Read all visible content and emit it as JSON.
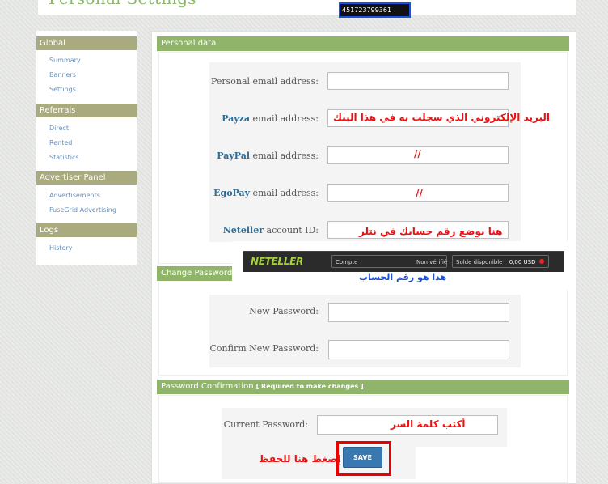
{
  "page_title": "Personal Settings",
  "sidebar": {
    "sections": [
      {
        "title": "Global",
        "items": [
          "Summary",
          "Banners",
          "Settings"
        ]
      },
      {
        "title": "Referrals",
        "items": [
          "Direct",
          "Rented",
          "Statistics"
        ]
      },
      {
        "title": "Advertiser Panel",
        "items": [
          "Advertisements",
          "FuseGrid Advertising"
        ]
      },
      {
        "title": "Logs",
        "items": [
          "History"
        ]
      }
    ]
  },
  "personal_data": {
    "header": "Personal data",
    "fields": {
      "personal_email": {
        "label": "Personal email address:",
        "value": ""
      },
      "payza": {
        "brand": "Payza",
        "label": " email address:",
        "value": ""
      },
      "paypal": {
        "brand": "PayPal",
        "label": " email address:",
        "value": ""
      },
      "egopay": {
        "brand": "EgoPay",
        "label": " email address:",
        "value": ""
      },
      "neteller": {
        "brand": "Neteller",
        "label": " account ID:",
        "value": ""
      }
    }
  },
  "annotations": {
    "payza_note": "البريد الإلكتروني الذي سجلت به في هذا البنك",
    "paypal_note": "//",
    "egopay_note": "//",
    "neteller_note": "هنا يوضع رقم حسابك في نتلر",
    "account_number_note": "هذا هو رقم الحساب",
    "password_note": "أكتب كلمة السر",
    "save_note": "إضغط هنا للحفظ"
  },
  "neteller_banner": {
    "logo": "NETELLER",
    "account_label": "Compte",
    "account_number": "451723799361",
    "status": "Non vérifié",
    "balance_label": "Solde disponible",
    "balance_value": "0,00 USD"
  },
  "change_password": {
    "header": "Change Password",
    "new_password_label": "New Password:",
    "confirm_password_label": "Confirm New Password:"
  },
  "password_confirmation": {
    "header": "Password Confirmation",
    "required_note": "[ Required to make changes ]",
    "current_password_label": "Current Password:",
    "save_label": "SAVE"
  },
  "colors": {
    "accent_green": "#8fb46a",
    "sidebar_head": "#a9aa7d",
    "link_blue": "#6b8fb5",
    "annotation_red": "#e11111",
    "annotation_blue": "#1a4fd6"
  }
}
